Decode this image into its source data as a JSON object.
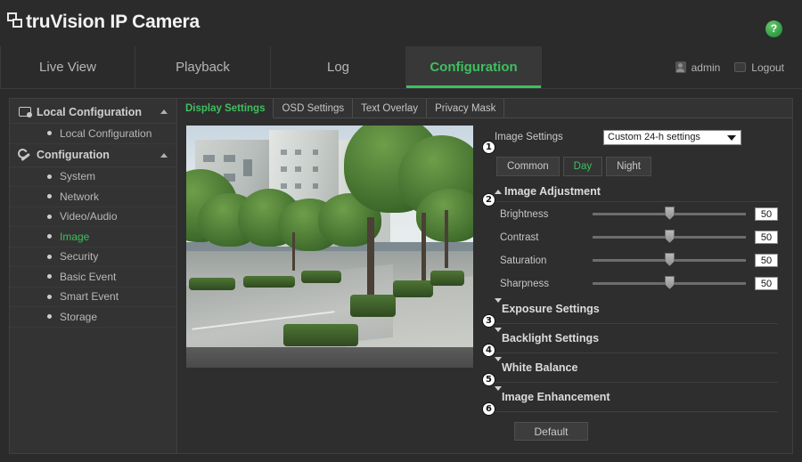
{
  "header": {
    "brand": "truVision  IP Camera",
    "help_icon": "help-icon",
    "help_glyph": "?"
  },
  "nav": {
    "tabs": [
      {
        "label": "Live View",
        "active": false
      },
      {
        "label": "Playback",
        "active": false
      },
      {
        "label": "Log",
        "active": false
      },
      {
        "label": "Configuration",
        "active": true
      }
    ],
    "user": "admin",
    "logout": "Logout"
  },
  "sidebar": {
    "groups": [
      {
        "title": "Local Configuration",
        "icon": "monitor-icon",
        "items": [
          {
            "label": "Local Configuration",
            "active": false
          }
        ]
      },
      {
        "title": "Configuration",
        "icon": "wrench-icon",
        "items": [
          {
            "label": "System",
            "active": false
          },
          {
            "label": "Network",
            "active": false
          },
          {
            "label": "Video/Audio",
            "active": false
          },
          {
            "label": "Image",
            "active": true
          },
          {
            "label": "Security",
            "active": false
          },
          {
            "label": "Basic Event",
            "active": false
          },
          {
            "label": "Smart Event",
            "active": false
          },
          {
            "label": "Storage",
            "active": false
          }
        ]
      }
    ]
  },
  "content": {
    "tabs": [
      {
        "label": "Display Settings",
        "active": true
      },
      {
        "label": "OSD Settings",
        "active": false
      },
      {
        "label": "Text Overlay",
        "active": false
      },
      {
        "label": "Privacy Mask",
        "active": false
      }
    ]
  },
  "settings": {
    "image_settings_label": "Image Settings",
    "image_settings_value": "Custom 24-h settings",
    "segments": [
      {
        "label": "Common",
        "active": false
      },
      {
        "label": "Day",
        "active": true
      },
      {
        "label": "Night",
        "active": false
      }
    ],
    "image_adjustment_title": "Image Adjustment",
    "sliders": [
      {
        "label": "Brightness",
        "value": "50",
        "pct": 50
      },
      {
        "label": "Contrast",
        "value": "50",
        "pct": 50
      },
      {
        "label": "Saturation",
        "value": "50",
        "pct": 50
      },
      {
        "label": "Sharpness",
        "value": "50",
        "pct": 50
      }
    ],
    "collapsed_sections": [
      {
        "label": "Exposure Settings"
      },
      {
        "label": "Backlight Settings"
      },
      {
        "label": "White Balance"
      },
      {
        "label": "Image Enhancement"
      }
    ],
    "default_button": "Default"
  },
  "stepnums": [
    "1",
    "2",
    "3",
    "4",
    "5",
    "6"
  ],
  "colors": {
    "accent_green": "#3fbf60",
    "page_bg": "#2b2b2b",
    "panel_bg": "#2e2e2e",
    "sidebar_bg": "#333333"
  }
}
